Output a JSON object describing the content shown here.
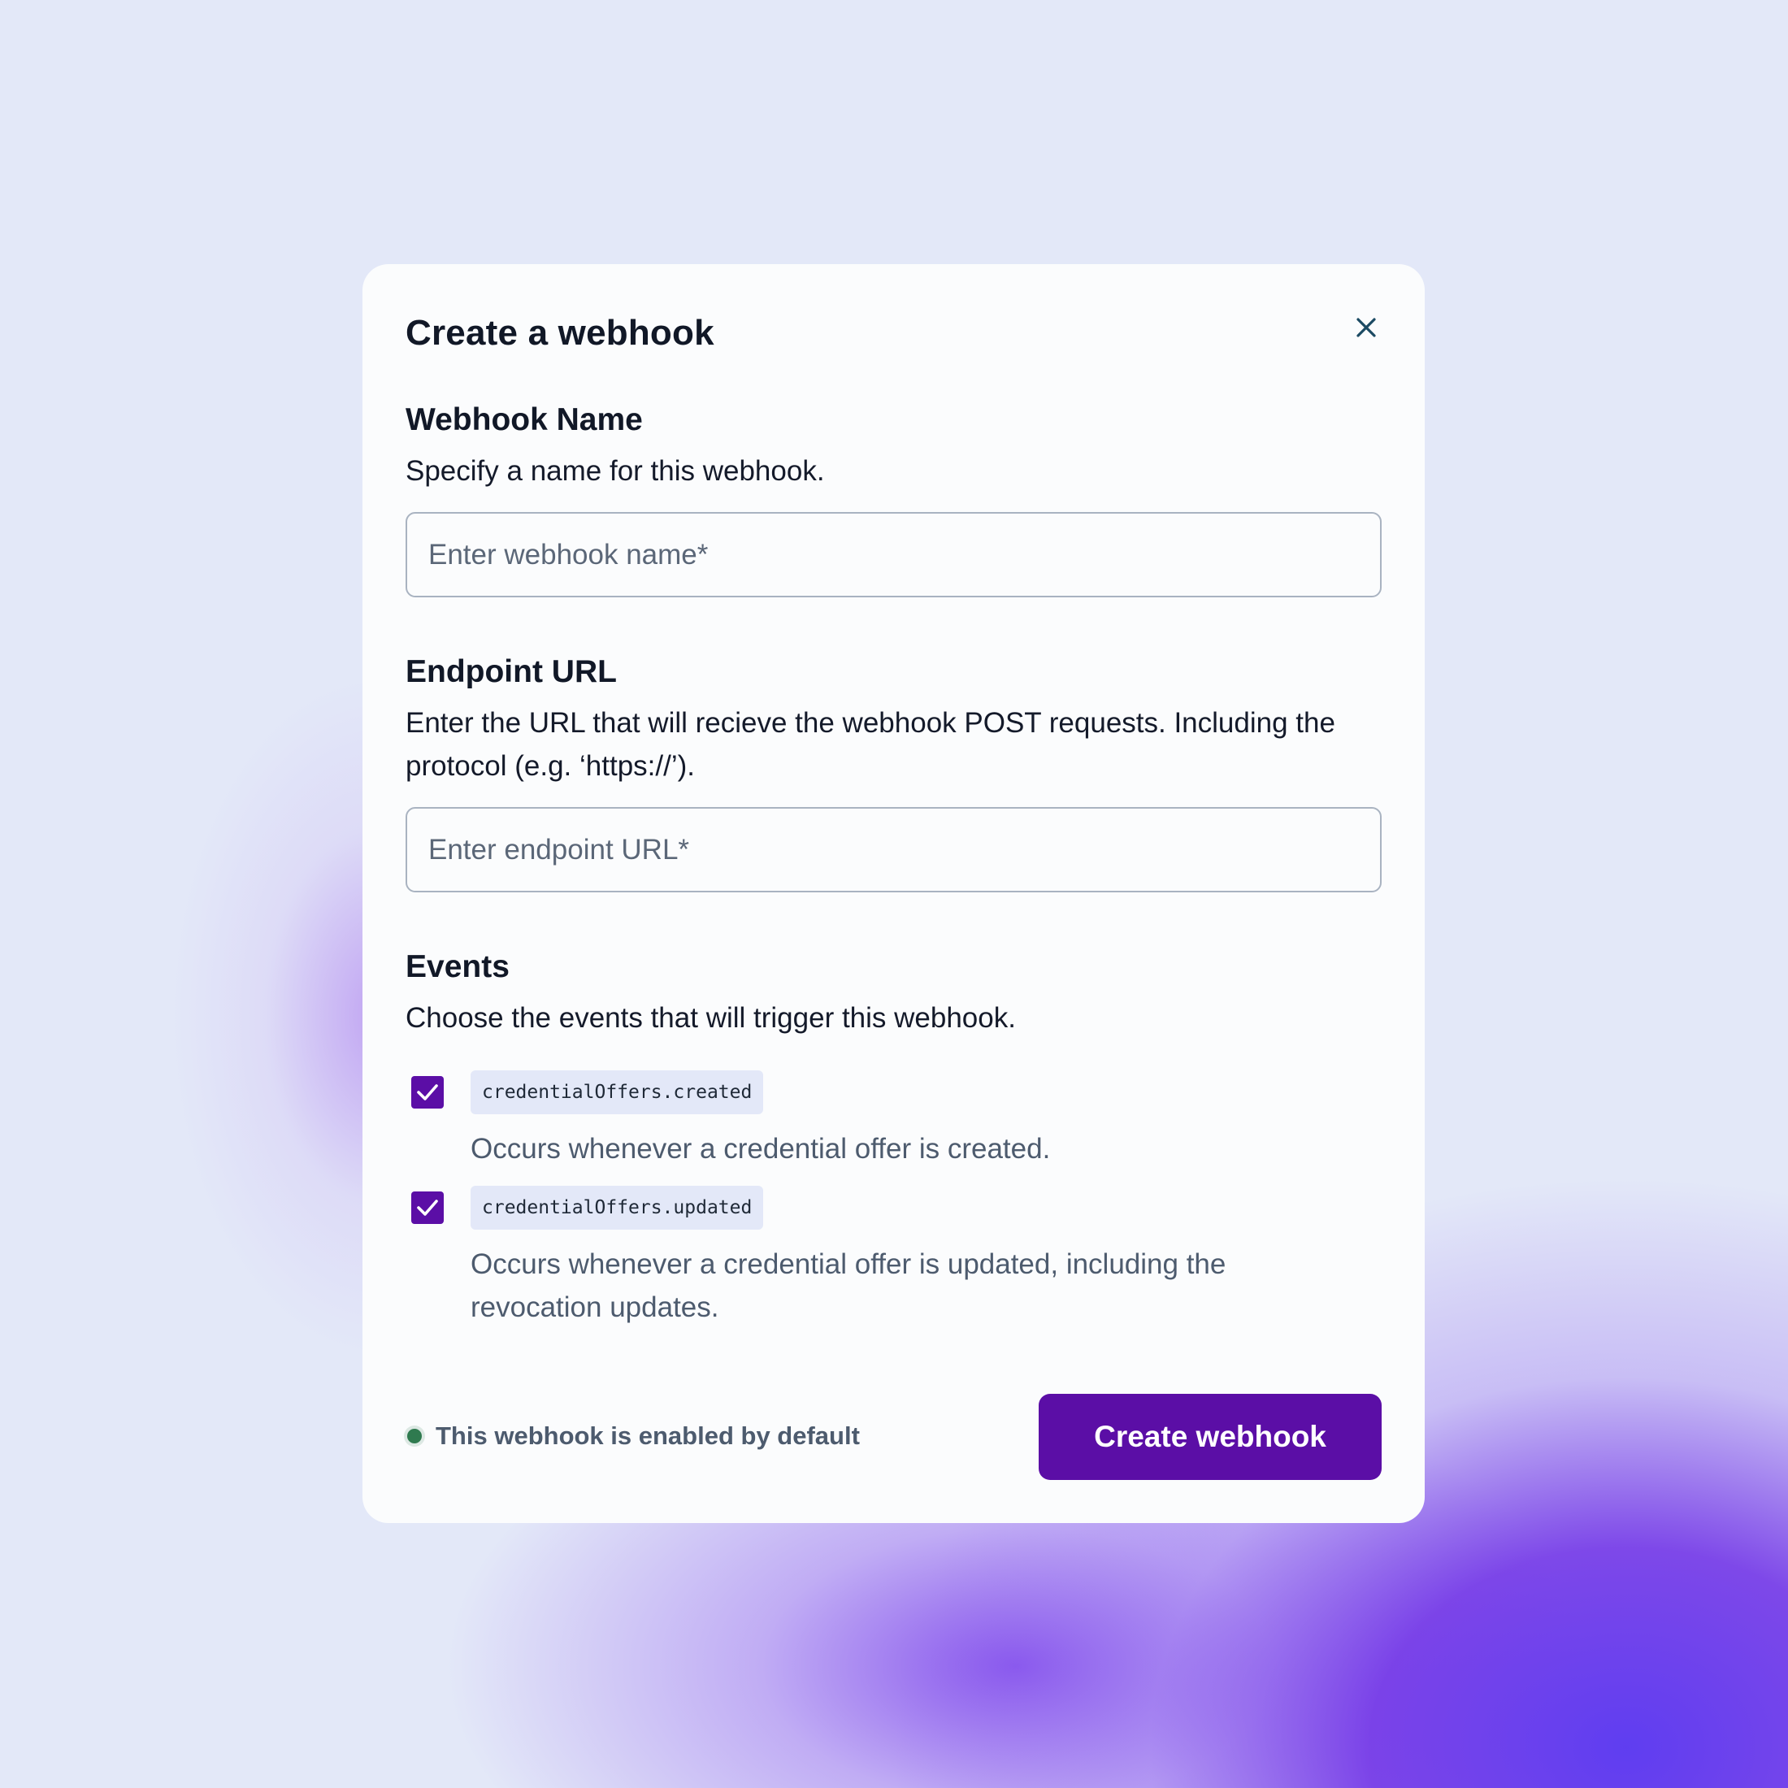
{
  "modal": {
    "title": "Create a webhook",
    "close_icon": "close-icon"
  },
  "name_section": {
    "heading": "Webhook Name",
    "description": "Specify a name for this webhook.",
    "input_value": "",
    "input_placeholder": "Enter webhook name*"
  },
  "url_section": {
    "heading": "Endpoint URL",
    "description": "Enter the URL that will recieve the webhook POST requests. Including the protocol (e.g. ‘https://’).",
    "input_value": "",
    "input_placeholder": "Enter endpoint URL*"
  },
  "events_section": {
    "heading": "Events",
    "description": "Choose the events that will trigger this webhook.",
    "events": [
      {
        "name": "credentialOffers.created",
        "description": "Occurs whenever a credential offer is created.",
        "checked": true,
        "check_icon": "checkmark-icon"
      },
      {
        "name": "credentialOffers.updated",
        "description": "Occurs whenever a credential offer is updated, including the revocation updates.",
        "checked": true,
        "check_icon": "checkmark-icon"
      }
    ]
  },
  "footer": {
    "status_text": "This webhook is enabled by default",
    "status_color": "#2f7a4f",
    "submit_label": "Create webhook"
  },
  "colors": {
    "accent": "#5b0ea6",
    "background": "#e3e8f8",
    "card": "#fbfcfd",
    "chip": "#e3e8f8"
  }
}
